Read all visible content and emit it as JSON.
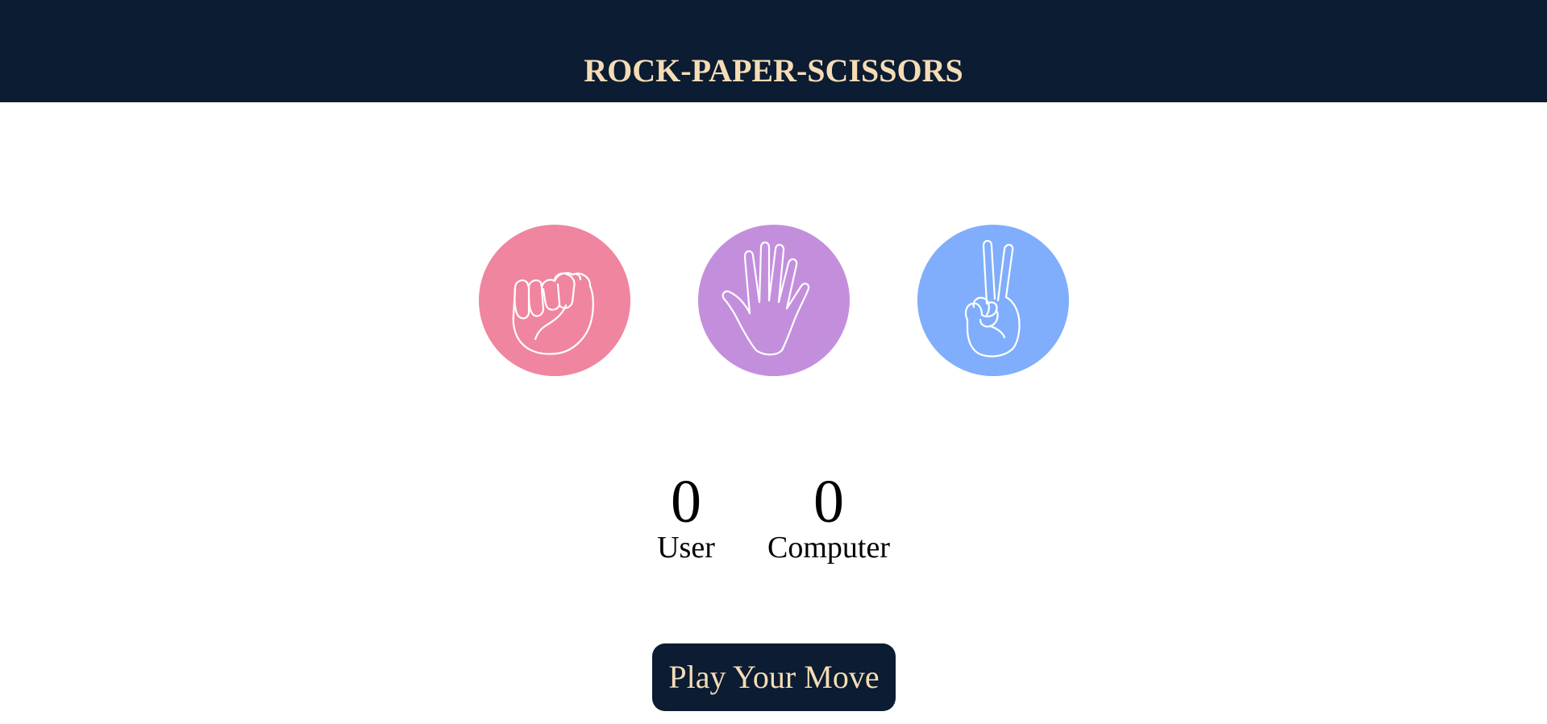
{
  "header": {
    "title": "ROCK-PAPER-SCISSORS",
    "background": "#0b1c33",
    "title_color": "#f6dcb4"
  },
  "choices": [
    {
      "id": "rock",
      "icon": "fist-icon",
      "color": "#f0859f"
    },
    {
      "id": "paper",
      "icon": "open-hand-icon",
      "color": "#c38fdd"
    },
    {
      "id": "scissors",
      "icon": "peace-hand-icon",
      "color": "#80aefc"
    }
  ],
  "scoreboard": {
    "user": {
      "score": "0",
      "label": "User"
    },
    "computer": {
      "score": "0",
      "label": "Computer"
    }
  },
  "play_button": {
    "label": "Play Your Move",
    "background": "#0b1c33",
    "text_color": "#f6dcb4"
  }
}
